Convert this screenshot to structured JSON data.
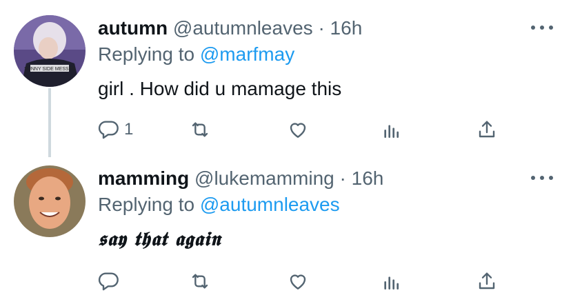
{
  "tweets": [
    {
      "name": "autumn",
      "handle": "@autumnleaves",
      "separator": "·",
      "time": "16h",
      "replying_prefix": "Replying to",
      "replying_to": "@marfmay",
      "text": "girl . How did u  mamage this",
      "reply_count": "1",
      "avatar_text": "SUNNY SIDE MESSES"
    },
    {
      "name": "mamming",
      "handle": "@lukemamming",
      "separator": "·",
      "time": "16h",
      "replying_prefix": "Replying to",
      "replying_to": "@autumnleaves",
      "text": "𝖘𝖆𝖞 𝖙𝖍𝖆𝖙 𝖆𝖌𝖆𝖎𝖓",
      "reply_count": ""
    }
  ],
  "icons": [
    "reply-icon",
    "retweet-icon",
    "like-icon",
    "analytics-icon",
    "share-icon",
    "more-icon"
  ],
  "colors": {
    "text": "#0f1419",
    "secondary": "#536471",
    "link": "#1d9bf0",
    "thread_line": "#cfd9de"
  }
}
